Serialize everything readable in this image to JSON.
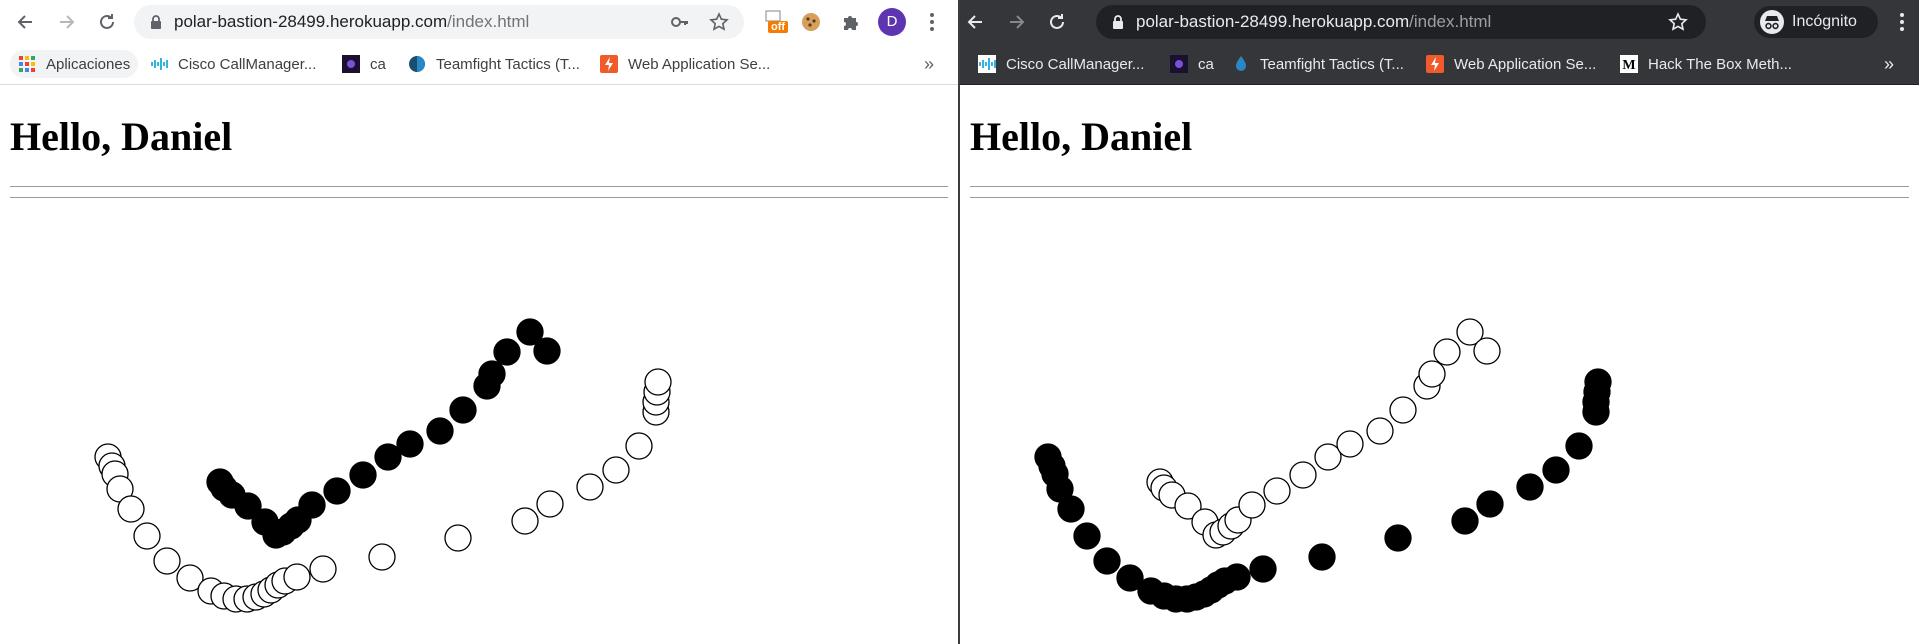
{
  "windows": [
    {
      "id": "left",
      "theme": "light",
      "url_host": "polar-bastion-28499.herokuapp.com",
      "url_path": "/index.html",
      "profile_initial": "D",
      "bookmarks": [
        {
          "label": "Aplicaciones",
          "icon": "apps-grid-icon"
        },
        {
          "label": "Cisco CallManager...",
          "icon": "cisco-icon"
        },
        {
          "label": "ca",
          "icon": "ca-favicon"
        },
        {
          "label": "Teamfight Tactics (T...",
          "icon": "tft-icon"
        },
        {
          "label": "Web Application Se...",
          "icon": "webapp-security-icon"
        }
      ],
      "more_bookmarks": "»",
      "heading": "Hello, Daniel"
    },
    {
      "id": "right",
      "theme": "dark",
      "url_host": "polar-bastion-28499.herokuapp.com",
      "url_path": "/index.html",
      "incognito_label": "Incógnito",
      "bookmarks": [
        {
          "label": "Cisco CallManager...",
          "icon": "cisco-icon"
        },
        {
          "label": "ca",
          "icon": "ca-favicon"
        },
        {
          "label": "Teamfight Tactics (T...",
          "icon": "tft-icon"
        },
        {
          "label": "Web Application Se...",
          "icon": "webapp-security-icon"
        },
        {
          "label": "Hack The Box Meth...",
          "icon": "medium-icon"
        }
      ],
      "more_bookmarks": "»",
      "heading": "Hello, Daniel"
    }
  ],
  "ext_badge": "off",
  "colors": {
    "filled_circle": "#000000",
    "hollow_circle": "#ffffff",
    "profile_avatar": "#5e35b1",
    "dark_toolbar": "#35363a"
  }
}
